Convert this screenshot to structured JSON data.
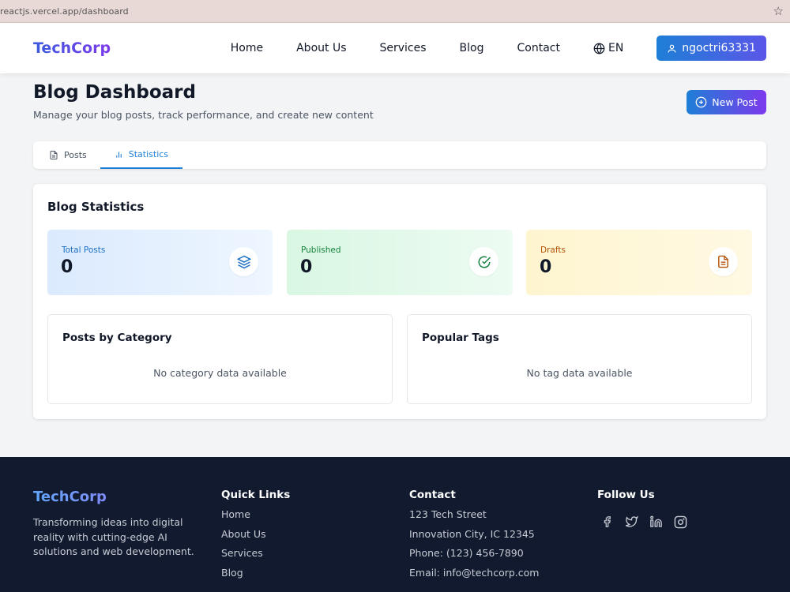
{
  "browser": {
    "url": "reactjs.vercel.app/dashboard"
  },
  "nav": {
    "brand": "TechCorp",
    "links": [
      "Home",
      "About Us",
      "Services",
      "Blog",
      "Contact"
    ],
    "lang": "EN",
    "user": "ngoctri63331"
  },
  "header": {
    "title": "Blog Dashboard",
    "subtitle": "Manage your blog posts, track performance, and create new content",
    "new_post": "New Post"
  },
  "tabs": [
    {
      "label": "Posts",
      "icon": "document-icon"
    },
    {
      "label": "Statistics",
      "icon": "bar-chart-icon",
      "active": true
    }
  ],
  "stats": {
    "title": "Blog Statistics",
    "cards": [
      {
        "label": "Total Posts",
        "value": "0",
        "icon": "layers-icon",
        "color": "#1d6fc2"
      },
      {
        "label": "Published",
        "value": "0",
        "icon": "check-circle-icon",
        "color": "#15803d"
      },
      {
        "label": "Drafts",
        "value": "0",
        "icon": "file-text-icon",
        "color": "#b45309"
      }
    ],
    "category": {
      "title": "Posts by Category",
      "empty": "No category data available"
    },
    "tags": {
      "title": "Popular Tags",
      "empty": "No tag data available"
    }
  },
  "footer": {
    "brand": "TechCorp",
    "description": "Transforming ideas into digital reality with cutting-edge AI solutions and web development.",
    "quick_links": {
      "title": "Quick Links",
      "items": [
        "Home",
        "About Us",
        "Services",
        "Blog"
      ]
    },
    "contact": {
      "title": "Contact",
      "items": [
        "123 Tech Street",
        "Innovation City, IC 12345",
        "Phone: (123) 456-7890",
        "Email: info@techcorp.com"
      ]
    },
    "follow": {
      "title": "Follow Us",
      "icons": [
        "facebook-icon",
        "twitter-icon",
        "linkedin-icon",
        "instagram-icon"
      ]
    }
  }
}
